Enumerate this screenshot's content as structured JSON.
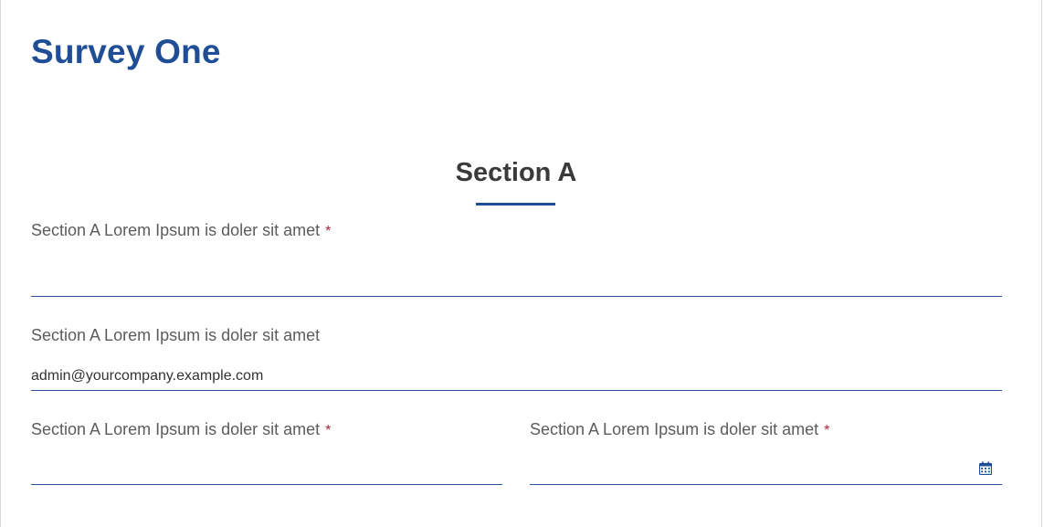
{
  "survey": {
    "title": "Survey One"
  },
  "section": {
    "title": "Section A"
  },
  "questions": [
    {
      "label": "Section A Lorem Ipsum is doler sit amet",
      "required": true,
      "required_mark": "*",
      "value": ""
    },
    {
      "label": "Section A Lorem Ipsum is doler sit amet",
      "required": false,
      "value": "admin@yourcompany.example.com"
    },
    {
      "label": "Section A Lorem Ipsum is doler sit amet",
      "required": true,
      "required_mark": "*",
      "value": ""
    },
    {
      "label": "Section A Lorem Ipsum is doler sit amet",
      "required": true,
      "required_mark": "*",
      "value": "",
      "icon": "calendar-icon"
    }
  ],
  "colors": {
    "brand": "#1f4e96",
    "required": "#b0243a",
    "label": "#5c5c5c"
  }
}
